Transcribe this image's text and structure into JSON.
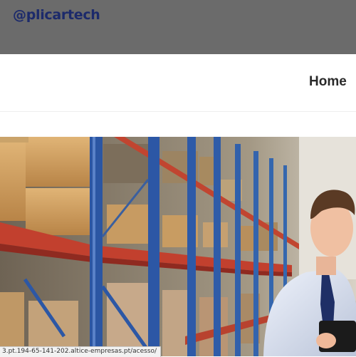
{
  "header": {
    "logo_text": "@plicartech",
    "brand_color": "#1c2a6b",
    "background": "#6b6b6b"
  },
  "nav": {
    "items": [
      {
        "label": "Home"
      }
    ]
  },
  "hero": {
    "image_description_icon": "warehouse-photo"
  },
  "status_bar": {
    "url": "3.pt.194-65-141-202.altice-empresas.pt/acesso/"
  }
}
